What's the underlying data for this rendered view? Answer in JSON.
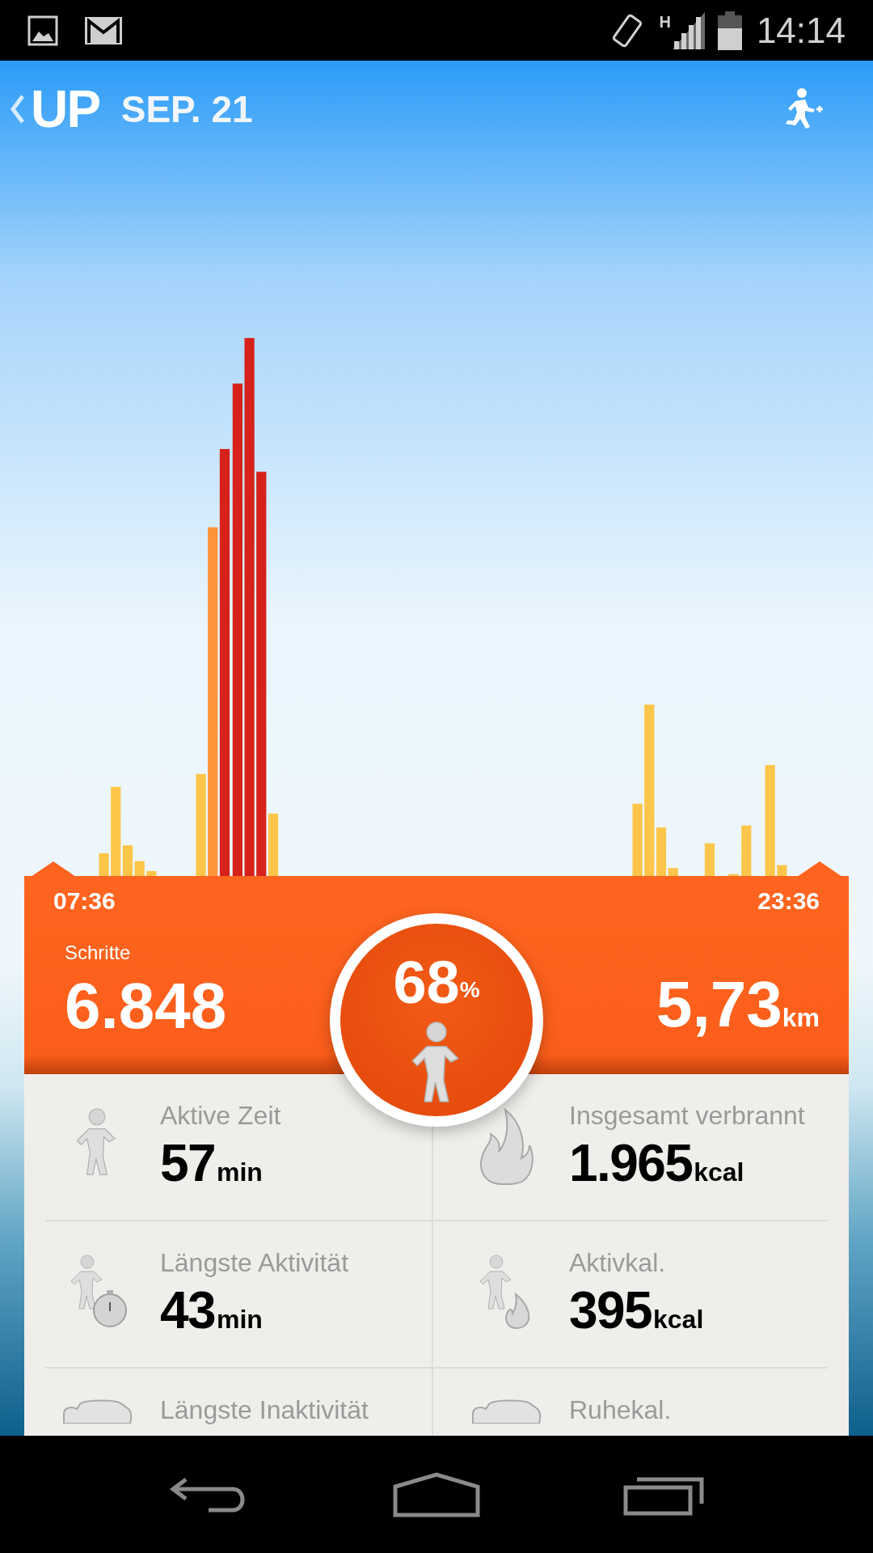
{
  "status_bar": {
    "time": "14:14",
    "network": "H"
  },
  "header": {
    "logo": "UP",
    "date": "SEP. 21"
  },
  "summary": {
    "start_time": "07:36",
    "end_time": "23:36",
    "steps_label": "Schritte",
    "steps": "6.848",
    "goal_value": "68",
    "goal_unit": "%",
    "distance": "5,73",
    "distance_unit": "km"
  },
  "stats": [
    {
      "kind": "active_time",
      "label": "Aktive Zeit",
      "value": "57",
      "unit": "min"
    },
    {
      "kind": "total_burn",
      "label": "Insgesamt verbrannt",
      "value": "1.965",
      "unit": "kcal"
    },
    {
      "kind": "longest_active",
      "label": "Längste Aktivität",
      "value": "43",
      "unit": "min"
    },
    {
      "kind": "active_cal",
      "label": "Aktivkal.",
      "value": "395",
      "unit": "kcal"
    },
    {
      "kind": "longest_idle",
      "label": "Längste Inaktivität"
    },
    {
      "kind": "rest_cal",
      "label": "Ruhekal."
    }
  ]
}
